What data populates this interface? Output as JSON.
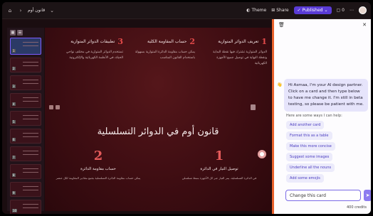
{
  "topbar": {
    "breadcrumb": "قانون أوم",
    "theme_label": "Theme",
    "share_label": "Share",
    "published_label": "Published",
    "comment_count": "0"
  },
  "rail": {
    "thumbs": [
      "1",
      "2",
      "3",
      "4",
      "5",
      "6",
      "7",
      "8",
      "9",
      "10"
    ]
  },
  "slide": {
    "columns": [
      {
        "num": "1",
        "heading": "تعريف الدوائر المتوازية",
        "body": "الدوائر المتوازية تشترك فيها نقطة البداية ونقطة النهاية في توصيل جميع الأجهزة الكهربائية"
      },
      {
        "num": "2",
        "heading": "حساب المقاومة الكلية",
        "body": "يمكن حساب مقاومة الدائرة المتوازية بسهولة باستخدام القانون المناسب"
      },
      {
        "num": "3",
        "heading": "تطبيقات الدوائر المتوازية",
        "body": "تستخدم الدوائر المتوازية في مختلف نواحي الحياة، في الأنظمة الكهربائية والإلكترونية"
      }
    ],
    "title": "قانون أوم في الدوائر التسلسلية",
    "bottom": [
      {
        "num": "1",
        "heading": "توصيل التيار في الدائرة",
        "body": "في الدائرة التسلسلية، يمر التيار عبر كل الأجهزة بنمط تسلسلي"
      },
      {
        "num": "2",
        "heading": "حساب مقاومة الدائرة",
        "body": "يمكن حساب مقاومة الدائرة التسلسلية بجمع مقادير المقاومة لكل عنصر"
      }
    ]
  },
  "panel": {
    "message": "Hi Asmaa, I'm your AI design partner. Click on a card and then type below to have me change it. I'm still in beta testing, so please be patient with me.",
    "ways_label": "Here are some ways I can help:",
    "chips": [
      "Add another card",
      "Format this as a table",
      "Make this more concise",
      "Suggest some images",
      "Underline all the nouns",
      "Add some emojis"
    ],
    "input_value": "Change this card",
    "credits": "400 credits"
  }
}
